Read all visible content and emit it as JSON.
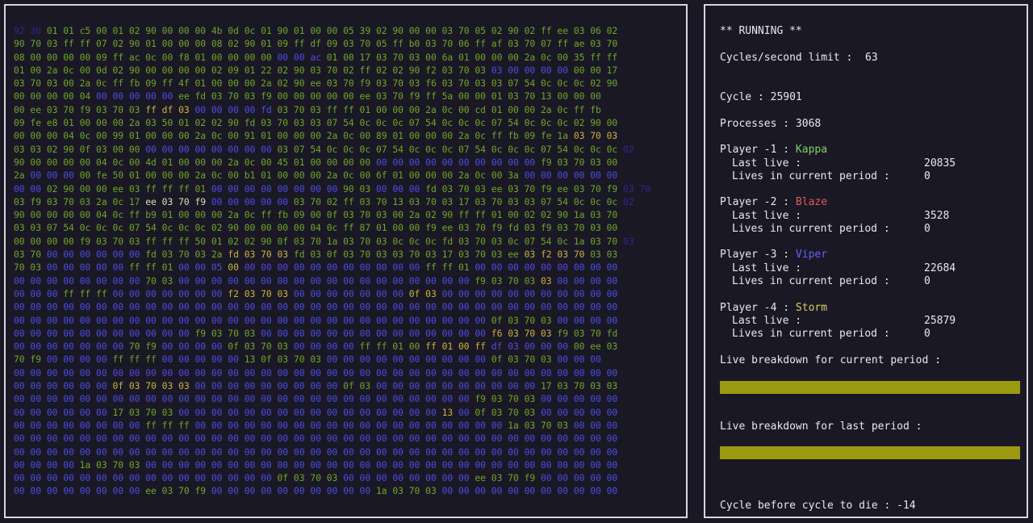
{
  "arena": {
    "memory_rows": []
  },
  "status": {
    "state": "** RUNNING **",
    "cycles_limit_label": "Cycles/second limit :",
    "cycles_limit": "63",
    "cycle_label": "Cycle :",
    "cycle": "25901",
    "processes_label": "Processes :",
    "processes": "3068"
  },
  "players": [
    {
      "label": "Player -1 :",
      "name": "Kappa",
      "last_live_label": "Last live :",
      "last_live": "20835",
      "lives_label": "Lives in current period :",
      "lives": "0",
      "color": "#79d45e"
    },
    {
      "label": "Player -2 :",
      "name": "Blaze",
      "last_live_label": "Last live :",
      "last_live": "3528",
      "lives_label": "Lives in current period :",
      "lives": "0",
      "color": "#e05a56"
    },
    {
      "label": "Player -3 :",
      "name": "Viper",
      "last_live_label": "Last live :",
      "last_live": "22684",
      "lives_label": "Lives in current period :",
      "lives": "0",
      "color": "#6363ee"
    },
    {
      "label": "Player -4 :",
      "name": "Storm",
      "last_live_label": "Last live :",
      "last_live": "25879",
      "lives_label": "Lives in current period :",
      "lives": "0",
      "color": "#e0cc5a"
    }
  ],
  "breakdown": {
    "current_label": "Live breakdown for current period :",
    "last_label": "Live breakdown for last period :",
    "bar_color": "#9b9a10"
  },
  "footer": {
    "cycle_to_die_label": "Cycle before cycle to die :",
    "cycle_to_die": "-14"
  }
}
